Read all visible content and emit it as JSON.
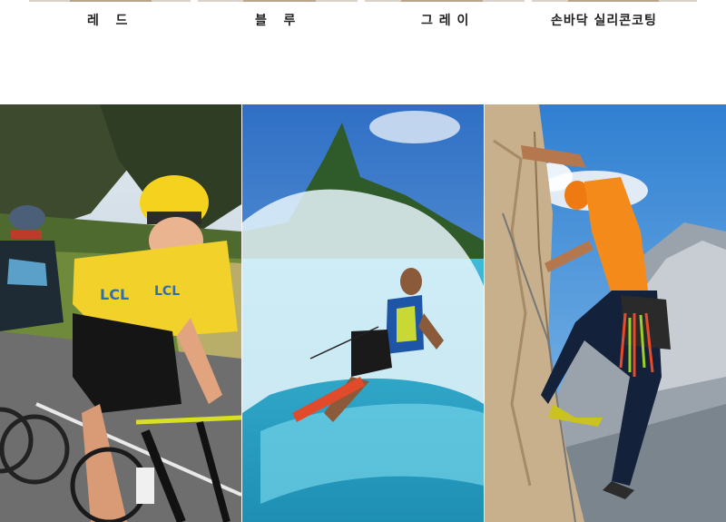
{
  "color_options": [
    {
      "label": "레   드",
      "swatch": "#c0392b"
    },
    {
      "label": "블   루",
      "swatch": "#2c5aa0"
    },
    {
      "label": "그 레 이",
      "swatch": "#8a8a8a"
    },
    {
      "label": "손바닥 실리콘코팅",
      "swatch": "#6b6b6b"
    }
  ],
  "photos": [
    {
      "subject": "cycling"
    },
    {
      "subject": "water-skiing"
    },
    {
      "subject": "rock-climbing"
    }
  ]
}
